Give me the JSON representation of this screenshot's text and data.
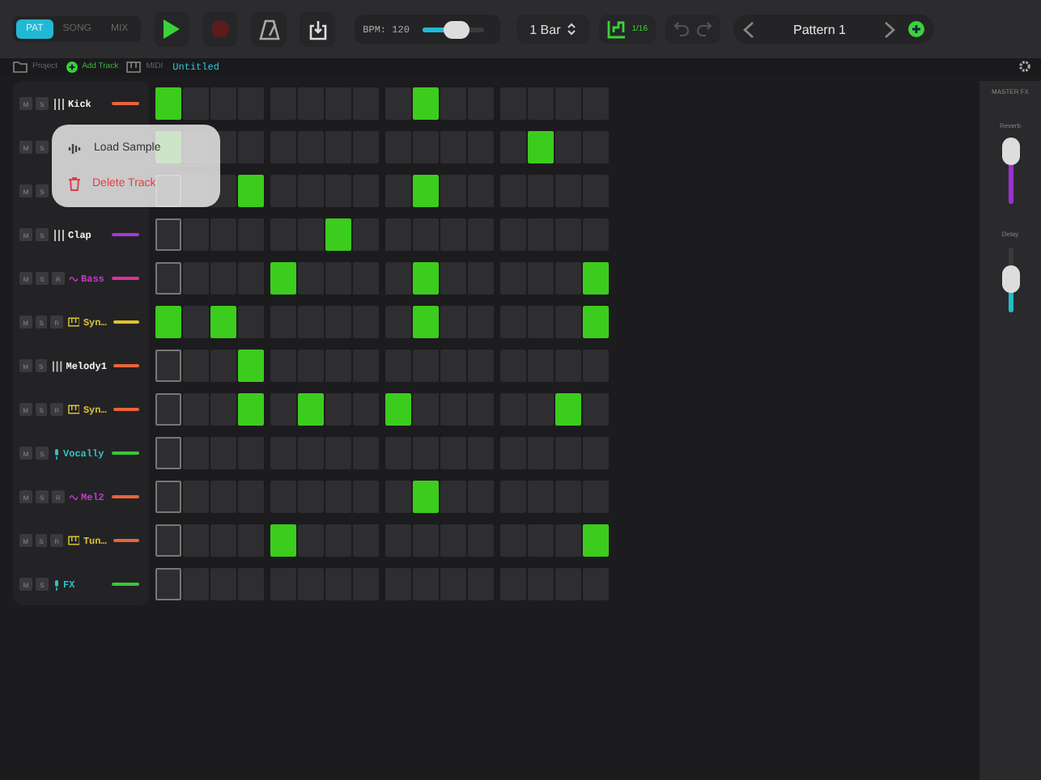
{
  "toolbar": {
    "tabs": [
      {
        "label": "PAT",
        "selected": true
      },
      {
        "label": "SONG",
        "selected": false
      },
      {
        "label": "MIX",
        "selected": false
      }
    ],
    "playing": false,
    "bpm_label": "BPM: 120",
    "bpm_level": {
      "level": 0.55
    },
    "bar_length": "1 Bar",
    "step_size": "1/16",
    "undo_disabled": true,
    "pattern": "Pattern 1"
  },
  "project_bar": {
    "project": "Project",
    "add_track": "Add Track",
    "midi": "MIDI",
    "title": "Untitled"
  },
  "tracks": [
    {
      "mute": "M",
      "solo": "S",
      "name": "Kick",
      "kind": "drum",
      "color": "#e8643c",
      "steps": [
        true,
        false,
        false,
        false,
        false,
        false,
        false,
        false,
        false,
        true,
        false,
        false,
        false,
        false,
        false,
        false
      ]
    },
    {
      "mute": "M",
      "solo": "S",
      "kind": "hidden",
      "steps": [
        true,
        false,
        false,
        false,
        false,
        false,
        false,
        false,
        false,
        false,
        false,
        false,
        false,
        true,
        false,
        false
      ]
    },
    {
      "mute": "M",
      "solo": "S",
      "kind": "hidden",
      "steps": [
        false,
        false,
        false,
        true,
        false,
        false,
        false,
        false,
        false,
        true,
        false,
        false,
        false,
        false,
        false,
        false
      ]
    },
    {
      "mute": "M",
      "solo": "S",
      "name": "Clap",
      "kind": "drum",
      "color": "#a23ad6",
      "steps": [
        false,
        false,
        false,
        false,
        false,
        false,
        true,
        false,
        false,
        false,
        false,
        false,
        false,
        false,
        false,
        false
      ]
    },
    {
      "mute": "M",
      "solo": "S",
      "record": "R",
      "name": "Bass",
      "kind": "bass",
      "color": "#e0309a",
      "steps": [
        false,
        false,
        false,
        false,
        true,
        false,
        false,
        false,
        false,
        true,
        false,
        false,
        false,
        false,
        false,
        true
      ]
    },
    {
      "mute": "M",
      "solo": "S",
      "record": "R",
      "name": "Syn…",
      "kind": "synth",
      "color": "#e0c030",
      "steps": [
        true,
        false,
        true,
        false,
        false,
        false,
        false,
        false,
        false,
        true,
        false,
        false,
        false,
        false,
        false,
        true
      ]
    },
    {
      "mute": "M",
      "solo": "S",
      "name": "Melody1",
      "kind": "drum",
      "color": "#e8643c",
      "steps": [
        false,
        false,
        false,
        true,
        false,
        false,
        false,
        false,
        false,
        false,
        false,
        false,
        false,
        false,
        false,
        false
      ]
    },
    {
      "mute": "M",
      "solo": "S",
      "record": "R",
      "name": "Syn…",
      "kind": "synth",
      "color": "#e8643c",
      "steps": [
        false,
        false,
        false,
        true,
        false,
        true,
        false,
        false,
        true,
        false,
        false,
        false,
        false,
        false,
        true,
        false
      ]
    },
    {
      "mute": "M",
      "solo": "S",
      "name": "Vocally",
      "kind": "vocal",
      "color": "#38c838",
      "steps": [
        false,
        false,
        false,
        false,
        false,
        false,
        false,
        false,
        false,
        false,
        false,
        false,
        false,
        false,
        false,
        false
      ]
    },
    {
      "mute": "M",
      "solo": "S",
      "record": "R",
      "name": "Mel2",
      "kind": "bass",
      "color": "#e8643c",
      "steps": [
        false,
        false,
        false,
        false,
        false,
        false,
        false,
        false,
        false,
        true,
        false,
        false,
        false,
        false,
        false,
        false
      ]
    },
    {
      "mute": "M",
      "solo": "S",
      "record": "R",
      "name": "Tun…",
      "kind": "synth",
      "color": "#e8643c",
      "steps": [
        false,
        false,
        false,
        false,
        true,
        false,
        false,
        false,
        false,
        false,
        false,
        false,
        false,
        false,
        false,
        true
      ]
    },
    {
      "mute": "M",
      "solo": "S",
      "name": "FX",
      "kind": "vocal",
      "color": "#38c838",
      "steps": [
        false,
        false,
        false,
        false,
        false,
        false,
        false,
        false,
        false,
        false,
        false,
        false,
        false,
        false,
        false,
        false
      ]
    }
  ],
  "context_menu": {
    "items": [
      {
        "label": "Load Sample",
        "kind": "normal"
      },
      {
        "label": "Delete Track",
        "kind": "destructive"
      }
    ]
  },
  "master_fx": {
    "title": "MASTER FX",
    "sliders": [
      {
        "label": "Reverb",
        "level": 0.8,
        "color": "#9b30d0"
      },
      {
        "label": "Delay",
        "level": 0.5,
        "color": "#20c0c8"
      }
    ]
  }
}
